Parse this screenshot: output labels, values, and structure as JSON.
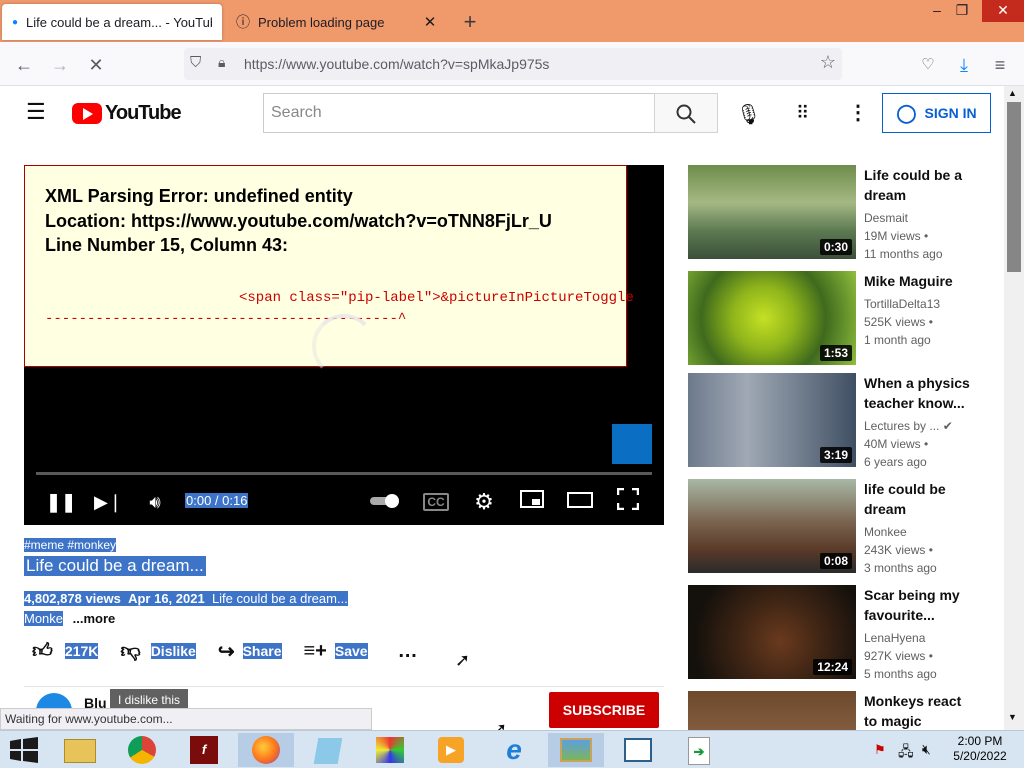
{
  "browser": {
    "tabs": [
      {
        "title": "Life could be a dream... - YouTube",
        "active": true
      },
      {
        "title": "Problem loading page",
        "active": false
      }
    ],
    "url": "https://www.youtube.com/watch?v=spMkaJp975s",
    "status": "Waiting for www.youtube.com..."
  },
  "youtube": {
    "logo_text": "YouTube",
    "search_placeholder": "Search",
    "signin_label": "SIGN IN"
  },
  "player": {
    "error_line1": "XML Parsing Error: undefined entity",
    "error_line2": "Location: https://www.youtube.com/watch?v=oTNN8FjLr_U",
    "error_line3": "Line Number 15, Column 43:",
    "error_code": "<span class=\"pip-label\">&pictureInPictureToggle",
    "error_marker": "------------------------------------------^",
    "time": "0:00 / 0:16",
    "progress": 0
  },
  "video": {
    "tags": "#meme #monkey",
    "title": "Life could be a dream...",
    "views": "4,802,878 views",
    "date": "Apr 16, 2021",
    "desc": "Life could be a dream...",
    "channel_short": "Monke",
    "more": "...more",
    "likes": "217K",
    "dislike": "Dislike",
    "share": "Share",
    "save": "Save",
    "channel_name": "Blu",
    "tooltip": "I dislike this",
    "subscribe": "SUBSCRIBE"
  },
  "recommendations": [
    {
      "title": "Life could be a dream",
      "channel": "Desmait",
      "views": "19M views",
      "age": "11 months ago",
      "duration": "0:30"
    },
    {
      "title": "Mike Maguire",
      "channel": "TortillaDelta13",
      "views": "525K views",
      "age": "1 month ago",
      "duration": "1:53"
    },
    {
      "title": "When a physics teacher know...",
      "channel": "Lectures by ...",
      "views": "40M views",
      "age": "6 years ago",
      "duration": "3:19"
    },
    {
      "title": "life could be dream",
      "channel": "Monkee",
      "views": "243K views",
      "age": "3 months ago",
      "duration": "0:08"
    },
    {
      "title": "Scar being my favourite...",
      "channel": "LenaHyena",
      "views": "927K views",
      "age": "5 months ago",
      "duration": "12:24"
    },
    {
      "title": "Monkeys react to magic",
      "channel": "",
      "views": "",
      "age": "",
      "duration": ""
    }
  ],
  "taskbar": {
    "time": "2:00 PM",
    "date": "5/20/2022"
  }
}
